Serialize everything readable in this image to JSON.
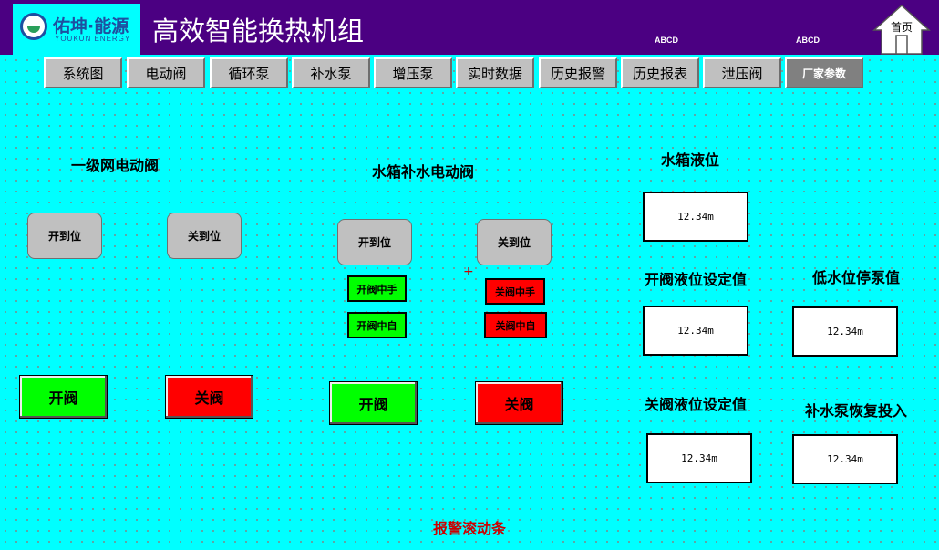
{
  "header": {
    "logo_cn": "佑坤·能源",
    "logo_en": "YOUKUN ENERGY",
    "title": "高效智能换热机组",
    "code_1": "ABCD",
    "code_2": "ABCD",
    "home_label": "首页"
  },
  "nav": {
    "items": [
      {
        "label": "系统图"
      },
      {
        "label": "电动阀"
      },
      {
        "label": "循环泵"
      },
      {
        "label": "补水泵"
      },
      {
        "label": "增压泵"
      },
      {
        "label": "实时数据"
      },
      {
        "label": "历史报警"
      },
      {
        "label": "历史报表"
      },
      {
        "label": "泄压阀"
      },
      {
        "label": "厂家参数"
      }
    ]
  },
  "primary_valve": {
    "title": "一级网电动阀",
    "open_status": "开到位",
    "close_status": "关到位",
    "open_button": "开阀",
    "close_button": "关阀"
  },
  "tank_valve": {
    "title": "水箱补水电动阀",
    "open_status": "开到位",
    "close_status": "关到位",
    "opening_manual": "开阀中手",
    "opening_auto": "开阀中自",
    "closing_manual": "关阀中手",
    "closing_auto": "关阀中自",
    "open_button": "开阀",
    "close_button": "关阀"
  },
  "levels": {
    "tank_level_label": "水箱液位",
    "tank_level_value": "12.34m",
    "open_setpoint_label": "开阀液位设定值",
    "open_setpoint_value": "12.34m",
    "low_stop_label": "低水位停泵值",
    "low_stop_value": "12.34m",
    "close_setpoint_label": "关阀液位设定值",
    "close_setpoint_value": "12.34m",
    "pump_resume_label": "补水泵恢复投入",
    "pump_resume_value": "12.34m"
  },
  "footer": {
    "alarm_ticker": "报警滚动条"
  },
  "colors": {
    "background": "#00ffff",
    "header": "#4b0082",
    "active_green": "#00ff00",
    "alarm_red": "#ff0000"
  }
}
